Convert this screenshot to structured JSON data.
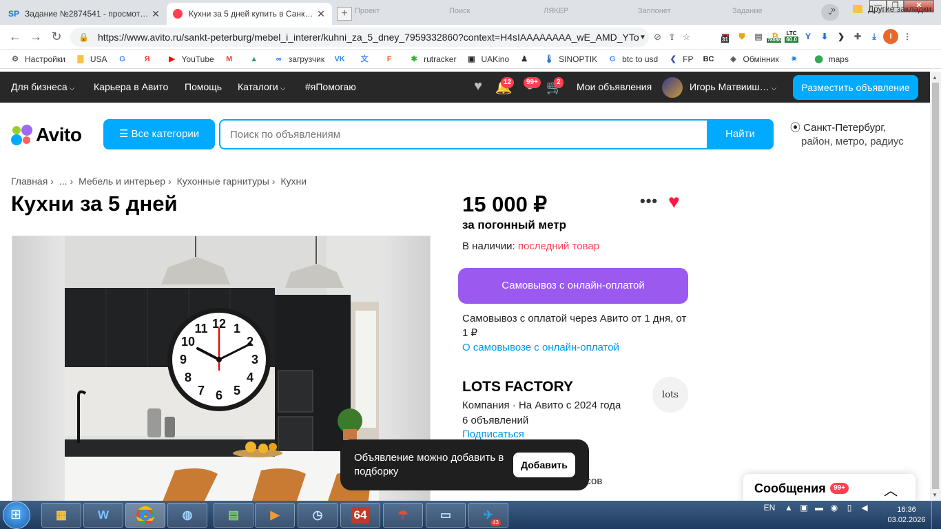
{
  "browser": {
    "tabs": [
      {
        "favicon": "SP",
        "title": "Задание №2874541 - просмотр з…",
        "close": "✕"
      },
      {
        "favicon": "avito-favicon",
        "title": "Кухни за 5 дней купить в Санкт-П",
        "close": "✕"
      }
    ],
    "new_tab": "+",
    "ghost_tabs": [
      "Проект",
      "Поиск",
      "ЛЯКЕР",
      "Заппонет",
      "Задание"
    ],
    "tab_menu": "⌄",
    "window": {
      "minimize": "—",
      "restore": "❐",
      "close": "✕"
    },
    "url": "https://www.avito.ru/sankt-peterburg/mebel_i_interer/kuhni_za_5_dney_7959332860?context=H4sIAAAAAAAA_wE_AMD_YToy...",
    "extensions": {
      "badge1": "31",
      "ltc_label": "LTC",
      "ltc_value": "60.0",
      "btc_value": "78088",
      "profile": "I"
    },
    "bookmarks": [
      {
        "icon": "gear-icon",
        "glyph": "⚙",
        "label": "Настройки",
        "color": "#5f6368"
      },
      {
        "icon": "folder-icon",
        "glyph": "▇",
        "label": "USA",
        "color": "#f6c343"
      },
      {
        "icon": "google-icon",
        "glyph": "G",
        "label": "",
        "color": "#4285f4"
      },
      {
        "icon": "yandex-icon",
        "glyph": "Я",
        "label": "",
        "color": "#ff3333"
      },
      {
        "icon": "youtube-icon",
        "glyph": "▶",
        "label": "YouTube",
        "color": "#ff0000"
      },
      {
        "icon": "gmail-icon",
        "glyph": "M",
        "label": "",
        "color": "#ea4335"
      },
      {
        "icon": "drive-icon",
        "glyph": "▲",
        "label": "",
        "color": "#1fa463"
      },
      {
        "icon": "infinity-icon",
        "glyph": "∞",
        "label": "загрузчик",
        "color": "#1a73e8"
      },
      {
        "icon": "vk-icon",
        "glyph": "VK",
        "label": "",
        "color": "#2787f5"
      },
      {
        "icon": "translate-icon",
        "glyph": "文",
        "label": "",
        "color": "#4285f4"
      },
      {
        "icon": "f-icon",
        "glyph": "F",
        "label": "",
        "color": "#ff5722"
      },
      {
        "icon": "rutracker-icon",
        "glyph": "✱",
        "label": "rutracker",
        "color": "#3cb043"
      },
      {
        "icon": "uakino-icon",
        "glyph": "▣",
        "label": "UAKino",
        "color": "#222222"
      },
      {
        "icon": "person-icon",
        "glyph": "♟",
        "label": "",
        "color": "#333333"
      },
      {
        "icon": "thermometer-icon",
        "glyph": "🌡",
        "label": "SINOPTIK",
        "color": "#1565c0"
      },
      {
        "icon": "google-icon",
        "glyph": "G",
        "label": "btc to usd",
        "color": "#4285f4"
      },
      {
        "icon": "fp-icon",
        "glyph": "❮",
        "label": "FP",
        "color": "#3f51b5"
      },
      {
        "icon": "bc-icon",
        "glyph": "BC",
        "label": "",
        "color": "#222222"
      },
      {
        "icon": "exchange-icon",
        "glyph": "◈",
        "label": "Обмінник",
        "color": "#555555"
      },
      {
        "icon": "star-icon",
        "glyph": "✷",
        "label": "",
        "color": "#1e88e5"
      },
      {
        "icon": "maps-icon",
        "glyph": "⬤",
        "label": "maps",
        "color": "#34a853"
      }
    ],
    "bookmarks_more": "»",
    "other_bookmarks": "Другие закладки"
  },
  "nav": {
    "business": "Для бизнеса",
    "career": "Карьера в Авито",
    "help": "Помощь",
    "catalogs": "Каталоги",
    "ihelp": "#яПомогаю",
    "notif_badge": "12",
    "msg_badge": "99+",
    "cart_badge": "2",
    "my_ads": "Мои объявления",
    "user": "Игорь Матвииш…",
    "post_ad": "Разместить объявление"
  },
  "header": {
    "logo": "Avito",
    "categories": "Все категории",
    "search_placeholder": "Поиск по объявлениям",
    "find": "Найти",
    "city": "Санкт-Петербург,",
    "city_sub": "район, метро, радиус"
  },
  "breadcrumbs": [
    "Главная",
    "...",
    "Мебель и интерьер",
    "Кухонные гарнитуры",
    "Кухни"
  ],
  "breadcrumb_sep": "›",
  "listing": {
    "title": "Кухни за 5 дней",
    "price": "15 000 ₽",
    "price_unit": "за погонный метр",
    "stock_label": "В наличии:",
    "stock_value": "последний товар",
    "pickup_button": "Самовывоз с онлайн-оплатой",
    "pickup_desc": "Самовывоз с оплатой через Авито от 1 дня, от 1 ₽",
    "pickup_link": "О самовывозе с онлайн-оплатой",
    "clock_numbers": [
      "12",
      "1",
      "2",
      "3",
      "4",
      "5",
      "6",
      "7",
      "8",
      "9",
      "10",
      "11"
    ]
  },
  "seller": {
    "name": "LOTS FACTORY",
    "type": "Компания · На Авито с 2024 года",
    "ads": "6 объявлений",
    "subscribe": "Подписаться",
    "logo_text": "lots",
    "partial_text": "асов"
  },
  "toast": {
    "message": "Объявление можно добавить в подборку",
    "button": "Добавить"
  },
  "messages": {
    "label": "Сообщения",
    "badge": "99+"
  },
  "taskbar": {
    "lang": "EN",
    "time": "16:36",
    "date": "03.02.2026",
    "telegram_badge": "43",
    "apps": [
      "explorer",
      "wise-care",
      "chrome",
      "network",
      "cpu-monitor",
      "media-player",
      "clock",
      "aida64",
      "umbrella",
      "notepad",
      "telegram"
    ],
    "aida_label": "64"
  },
  "colors": {
    "accent": "#00aaff",
    "pickup": "#9b59f0",
    "badge": "#ff4053",
    "heart": "#ff1744",
    "nav_bg": "#282828"
  }
}
